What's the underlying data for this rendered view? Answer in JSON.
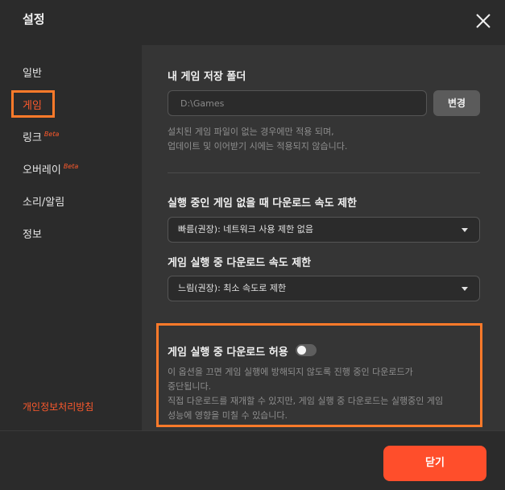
{
  "window": {
    "title": "설정"
  },
  "sidebar": {
    "items": [
      {
        "label": "일반"
      },
      {
        "label": "게임"
      },
      {
        "label": "링크",
        "badge": "Beta"
      },
      {
        "label": "오버레이",
        "badge": "Beta"
      },
      {
        "label": "소리/알림"
      },
      {
        "label": "정보"
      }
    ],
    "active": "게임",
    "privacy_link": "개인정보처리방침"
  },
  "game_folder": {
    "title": "내 게임 저장 폴더",
    "path": "D:\\Games",
    "change_button": "변경",
    "help_line1": "설치된 게임 파일이 없는 경우에만 적용 되며,",
    "help_line2": "업데이트 및 이어받기 시에는 적용되지 않습니다."
  },
  "download_idle": {
    "title": "실행 중인 게임 없을 때 다운로드 속도 제한",
    "selected": "빠름(권장): 네트워크 사용 제한 없음"
  },
  "download_playing": {
    "title": "게임 실행 중 다운로드 속도 제한",
    "selected": "느림(권장): 최소 속도로 제한"
  },
  "allow_download": {
    "label": "게임 실행 중 다운로드 허용",
    "enabled": false,
    "desc_line1": "이 옵션을 끄면 게임 실행에 방해되지 않도록 진행 중인 다운로드가",
    "desc_line2": "중단됩니다.",
    "desc_line3": "직접 다운로드를 재개할 수 있지만, 게임 실행 중 다운로드는 실행중인 게임",
    "desc_line4": "성능에 영향을 미칠 수 있습니다."
  },
  "footer": {
    "close_button": "닫기"
  },
  "colors": {
    "accent": "#ff4e2b",
    "highlight": "#ff7a2a",
    "background": "#2b2b2b",
    "panel": "#353535"
  },
  "icons": {
    "close": "close-icon",
    "dropdown": "chevron-down-icon"
  }
}
